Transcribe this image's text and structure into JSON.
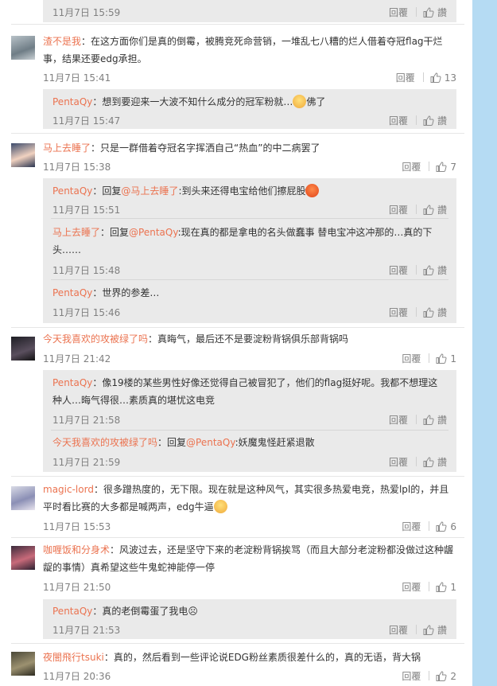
{
  "comments": [
    {
      "reply_label": "回覆",
      "like_label": "讚",
      "date": "11月7日 15:59"
    },
    {
      "user": "渣不是我",
      "text": "：在这方面你们是真的倒霉，被腾竞死命营销，一堆乱七八糟的烂人借着夺冠flag干烂事，结果还要edg承担。",
      "date": "11月7日 15:41",
      "reply_label": "回覆",
      "likes": "13",
      "replies": [
        {
          "user": "PentaQy",
          "text_before": "：想到要迎来一大波不知什么成分的冠军粉就…",
          "emoji": "sad-face-emoji",
          "text_after": "佛了",
          "date": "11月7日 15:47",
          "reply_label": "回覆",
          "like_label": "讚"
        }
      ]
    },
    {
      "user": "马上去睡了",
      "text": "：只是一群借着夺冠名字挥洒自己“热血”的中二病罢了",
      "date": "11月7日 15:38",
      "reply_label": "回覆",
      "likes": "7",
      "replies": [
        {
          "user": "PentaQy",
          "pre": "：回复",
          "mention": "@马上去睡了",
          "text": ":到头来还得电宝给他们擦屁股",
          "emoji": "angry-face-emoji",
          "date": "11月7日 15:51",
          "reply_label": "回覆",
          "like_label": "讚"
        },
        {
          "user": "马上去睡了",
          "pre": "：回复",
          "mention": "@PentaQy",
          "text": ":现在真的都是拿电的名头做蠢事 替电宝冲这冲那的…真的下头……",
          "date": "11月7日 15:48",
          "reply_label": "回覆",
          "like_label": "讚"
        },
        {
          "user": "PentaQy",
          "text": "：世界的参差…",
          "date": "11月7日 15:46",
          "reply_label": "回覆",
          "like_label": "讚"
        }
      ]
    },
    {
      "user": "今天我喜欢的攻被绿了吗",
      "text": "：真晦气，最后还不是要淀粉背锅俱乐部背锅吗",
      "date": "11月7日 21:42",
      "reply_label": "回覆",
      "likes": "1",
      "replies": [
        {
          "user": "PentaQy",
          "text": "：像19楼的某些男性好像还觉得自己被冒犯了，他们的flag挺好呢。我都不想理这种人…晦气得很…素质真的堪忧这电竞",
          "date": "11月7日 21:58",
          "reply_label": "回覆",
          "like_label": "讚"
        },
        {
          "user": "今天我喜欢的攻被绿了吗",
          "pre": "：回复",
          "mention": "@PentaQy",
          "text": ":妖魔鬼怪赶紧退散",
          "date": "11月7日 21:59",
          "reply_label": "回覆",
          "like_label": "讚"
        }
      ]
    },
    {
      "user": "magic-lord",
      "text": "：很多蹭热度的，无下限。现在就是这种风气，其实很多热爱电竞，热爱lpl的，并且平时看比赛的大多都是喊两声，edg牛逼",
      "emoji": "tongue-face-emoji",
      "date": "11月7日 15:53",
      "reply_label": "回覆",
      "likes": "6"
    },
    {
      "user": "咖喱饭和分身术",
      "text": "：风波过去，还是坚守下来的老淀粉背锅挨骂（而且大部分老淀粉都没做过这种龌龊的事情）真希望这些牛鬼蛇神能停一停",
      "date": "11月7日 21:50",
      "reply_label": "回覆",
      "likes": "1",
      "replies": [
        {
          "user": "PentaQy",
          "text": "：真的老倒霉蛋了我电☹",
          "date": "11月7日 21:53",
          "reply_label": "回覆",
          "like_label": "讚"
        }
      ]
    },
    {
      "user": "夜闇飛行tsuki",
      "text": "：真的，然后看到一些评论说EDG粉丝素质很差什么的，真的无语，背大锅",
      "date": "11月7日 20:36",
      "reply_label": "回覆",
      "likes": "2"
    }
  ],
  "colors": {
    "username": "#eb7350",
    "text": "#333333",
    "meta": "#808080",
    "subbox": "#eaeaea",
    "sidebar": "#b5dbf3"
  }
}
